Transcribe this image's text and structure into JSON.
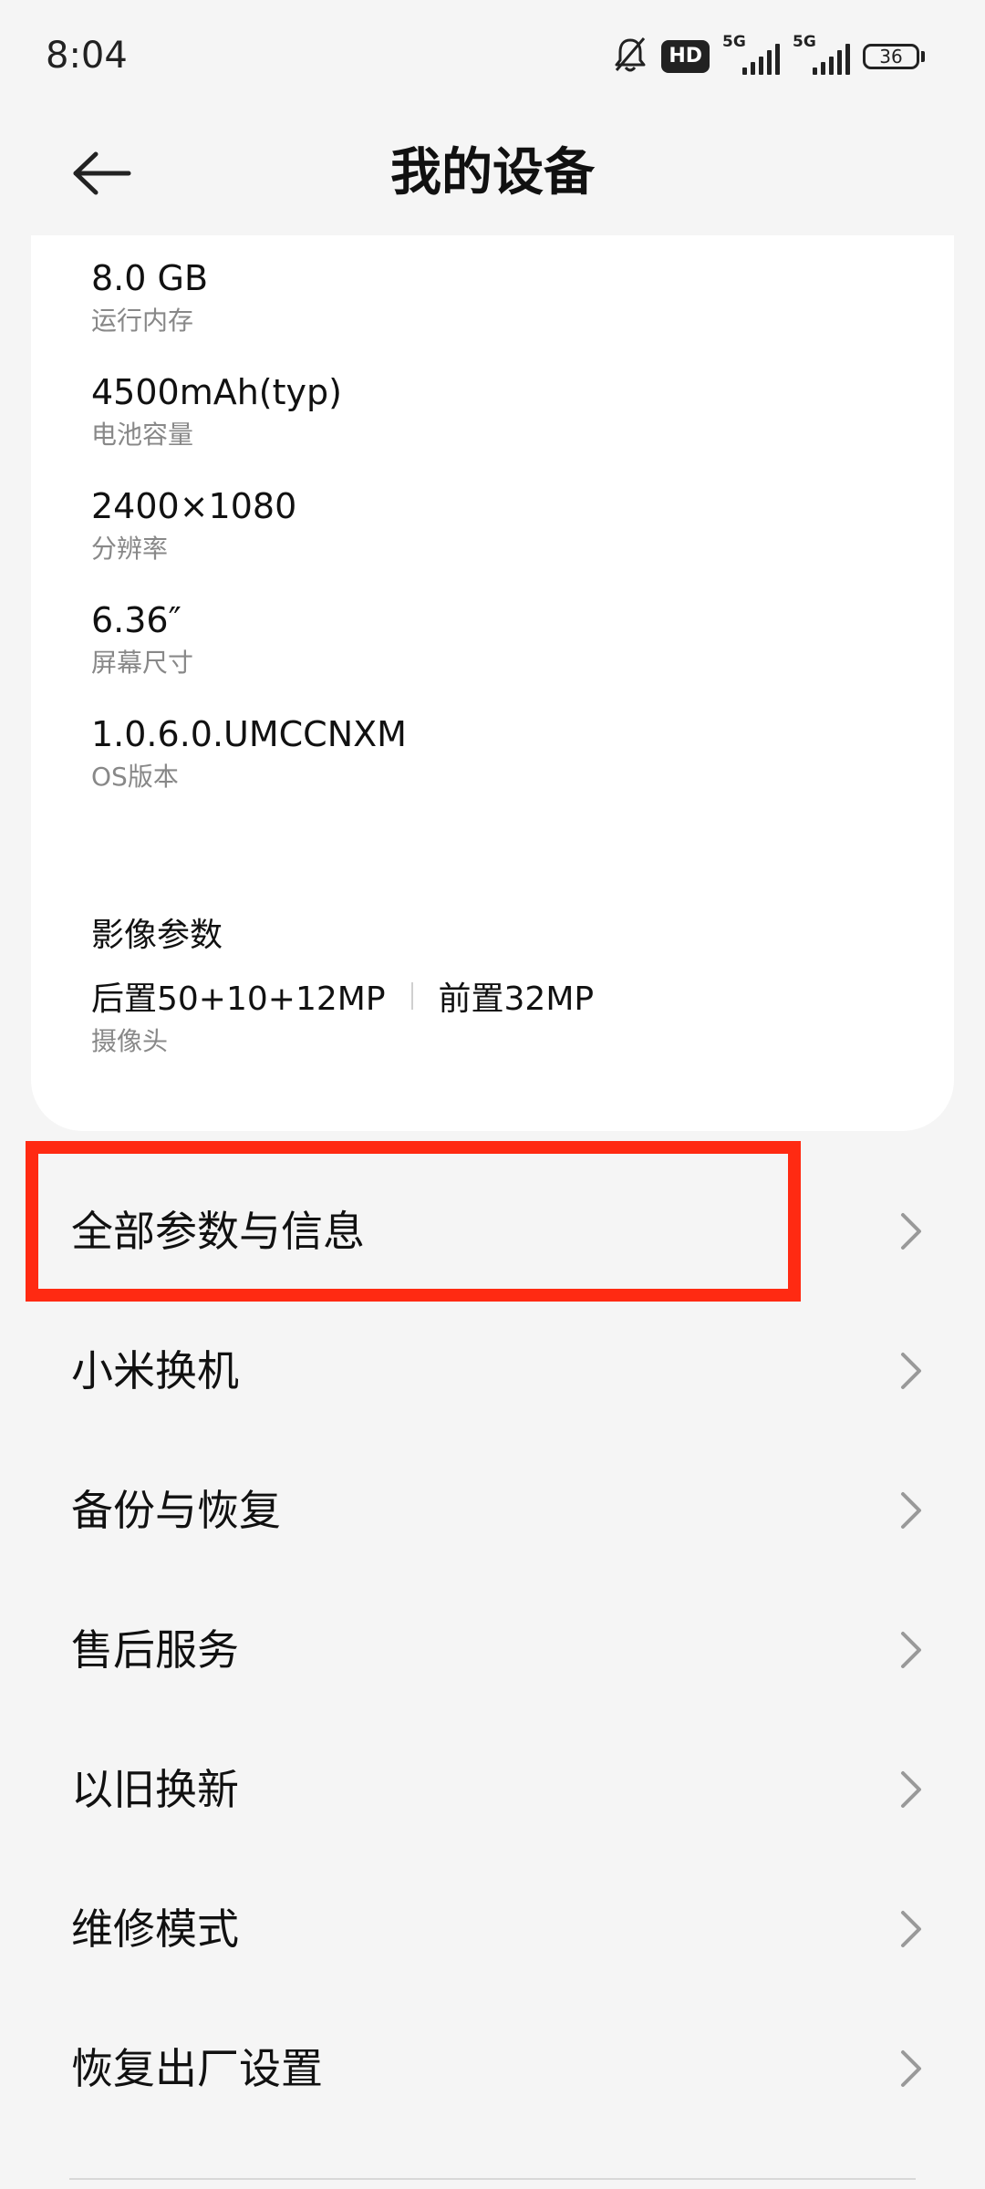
{
  "status_bar": {
    "time": "8:04",
    "hd_label": "HD",
    "network1": "5G",
    "network2": "5G",
    "battery": "36",
    "icons": [
      "mute-bell-icon",
      "hd-icon",
      "signal-icon",
      "signal-icon",
      "battery-icon"
    ]
  },
  "header": {
    "title": "我的设备",
    "back_icon": "back-arrow-icon"
  },
  "specs": [
    {
      "value": "8.0 GB",
      "label": "运行内存"
    },
    {
      "value": "4500mAh(typ)",
      "label": "电池容量"
    },
    {
      "value": "2400×1080",
      "label": "分辨率"
    },
    {
      "value": "6.36″",
      "label": "屏幕尺寸"
    },
    {
      "value": "1.0.6.0.UMCCNXM",
      "label": "OS版本"
    }
  ],
  "camera": {
    "title": "影像参数",
    "rear": "后置50+10+12MP",
    "front": "前置32MP",
    "label": "摄像头"
  },
  "menu": [
    {
      "label": "全部参数与信息",
      "icon": "chevron-right-icon"
    },
    {
      "label": "小米换机",
      "icon": "chevron-right-icon"
    },
    {
      "label": "备份与恢复",
      "icon": "chevron-right-icon"
    },
    {
      "label": "售后服务",
      "icon": "chevron-right-icon"
    },
    {
      "label": "以旧换新",
      "icon": "chevron-right-icon"
    },
    {
      "label": "维修模式",
      "icon": "chevron-right-icon"
    },
    {
      "label": "恢复出厂设置",
      "icon": "chevron-right-icon"
    }
  ],
  "colors": {
    "background": "#f5f5f5",
    "card": "#ffffff",
    "highlight": "#ff2a12",
    "secondary_text": "#888888"
  }
}
